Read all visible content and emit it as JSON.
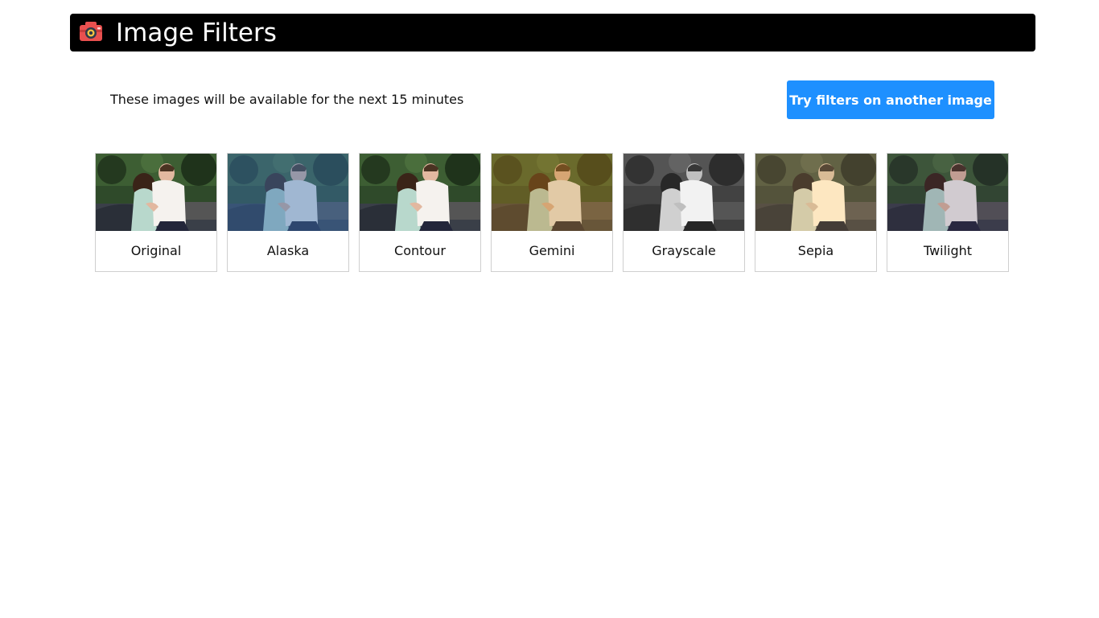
{
  "app": {
    "title": "Image Filters",
    "logo_icon": "camera-icon",
    "logo_color": "#e8504f"
  },
  "notice": {
    "text": "These images will be available for the next 15 minutes"
  },
  "actions": {
    "try_another_label": "Try filters on another image",
    "button_color": "#1e90ff"
  },
  "filters": [
    {
      "name": "Original",
      "tint": "none"
    },
    {
      "name": "Alaska",
      "tint": "#3a6fb0"
    },
    {
      "name": "Contour",
      "tint": "none"
    },
    {
      "name": "Gemini",
      "tint": "#c08020"
    },
    {
      "name": "Grayscale",
      "tint": "grayscale"
    },
    {
      "name": "Sepia",
      "tint": "sepia"
    },
    {
      "name": "Twilight",
      "tint": "#40305a"
    }
  ]
}
